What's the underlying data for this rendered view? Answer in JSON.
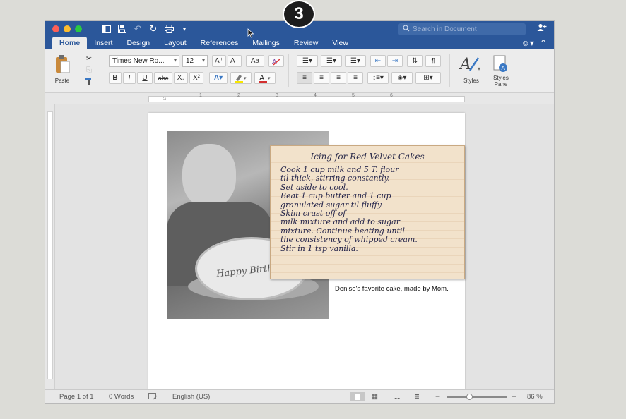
{
  "step_badge": "3",
  "titlebar": {
    "search_placeholder": "Search in Document",
    "quick_access": [
      "sidebar-icon",
      "save-icon",
      "undo-icon",
      "redo-icon",
      "print-icon",
      "customize-icon"
    ]
  },
  "tabs": [
    "Home",
    "Insert",
    "Design",
    "Layout",
    "References",
    "Mailings",
    "Review",
    "View"
  ],
  "active_tab": "Home",
  "ribbon": {
    "paste_label": "Paste",
    "font_name": "Times New Ro...",
    "font_size": "12",
    "bold": "B",
    "italic": "I",
    "underline": "U",
    "strikethrough": "abc",
    "subscript": "X₂",
    "superscript": "X²",
    "grow_font": "A⁺",
    "shrink_font": "A⁻",
    "change_case": "Aa",
    "styles_label": "Styles",
    "styles_pane_label": "Styles Pane",
    "font_color": "#d32f2f",
    "highlight_color": "#f6e600"
  },
  "ruler": {
    "ticks": [
      "1",
      "2",
      "3",
      "4",
      "5",
      "6"
    ]
  },
  "document": {
    "recipe_title": "Icing for Red Velvet Cakes",
    "recipe_lines": [
      "Cook 1 cup milk and 5 T. flour",
      "til thick, stirring constantly.",
      "Set aside to cool.",
      "Beat 1 cup butter and 1 cup",
      "granulated sugar til fluffy.",
      "Skim crust off of",
      "milk mixture and add to sugar",
      "mixture. Continue beating until",
      "the consistency of whipped cream.",
      "Stir in 1 tsp vanilla."
    ],
    "photo_text": "Happy Birthday",
    "caption": "Denise's favorite cake, made by Mom."
  },
  "statusbar": {
    "page": "Page 1 of 1",
    "words": "0 Words",
    "language": "English (US)",
    "zoom": "86 %",
    "zoom_minus": "−",
    "zoom_plus": "+"
  }
}
